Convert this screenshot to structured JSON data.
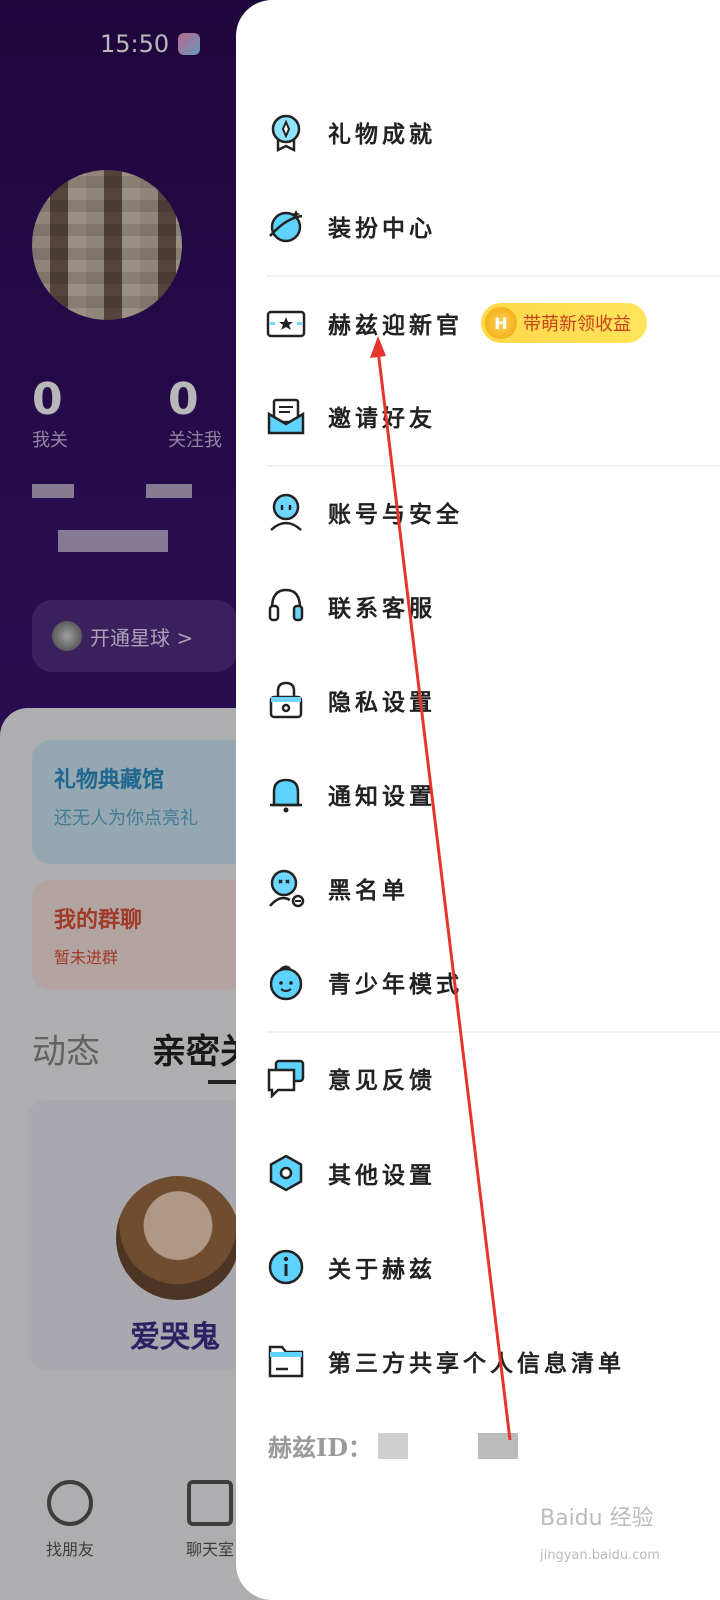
{
  "status_bar": {
    "time": "15:50"
  },
  "profile": {
    "stats": [
      {
        "value": "0",
        "label": "我关"
      },
      {
        "value": "0",
        "label": "关注我"
      }
    ],
    "open_planet": "开通星球 >"
  },
  "cards": {
    "gift_hall": {
      "title": "礼物典藏馆",
      "subtitle": "还无人为你点亮礼"
    },
    "my_groups": {
      "title": "我的群聊",
      "subtitle": "暂未进群"
    }
  },
  "tabs": [
    "动态",
    "亲密关"
  ],
  "friend": {
    "name": "爱哭鬼"
  },
  "bottom_nav": [
    "找朋友",
    "聊天室"
  ],
  "drawer": {
    "items": [
      {
        "label": "礼物成就",
        "icon": "medal-icon"
      },
      {
        "label": "装扮中心",
        "icon": "planet-icon"
      },
      {
        "label": "赫兹迎新官",
        "icon": "star-card-icon",
        "badge": "带萌新领收益",
        "badge_coin": "H"
      },
      {
        "label": "邀请好友",
        "icon": "envelope-icon"
      },
      {
        "label": "账号与安全",
        "icon": "user-icon"
      },
      {
        "label": "联系客服",
        "icon": "headset-icon"
      },
      {
        "label": "隐私设置",
        "icon": "lock-icon"
      },
      {
        "label": "通知设置",
        "icon": "bell-icon"
      },
      {
        "label": "黑名单",
        "icon": "blocked-user-icon"
      },
      {
        "label": "青少年模式",
        "icon": "child-face-icon"
      },
      {
        "label": "意见反馈",
        "icon": "chat-bubble-icon"
      },
      {
        "label": "其他设置",
        "icon": "hexagon-settings-icon"
      },
      {
        "label": "关于赫兹",
        "icon": "info-icon"
      },
      {
        "label": "第三方共享个人信息清单",
        "icon": "folder-icon"
      }
    ],
    "id_label": "赫兹ID："
  },
  "watermark": {
    "text": "Baidu 经验",
    "sub": "jingyan.baidu.com"
  }
}
